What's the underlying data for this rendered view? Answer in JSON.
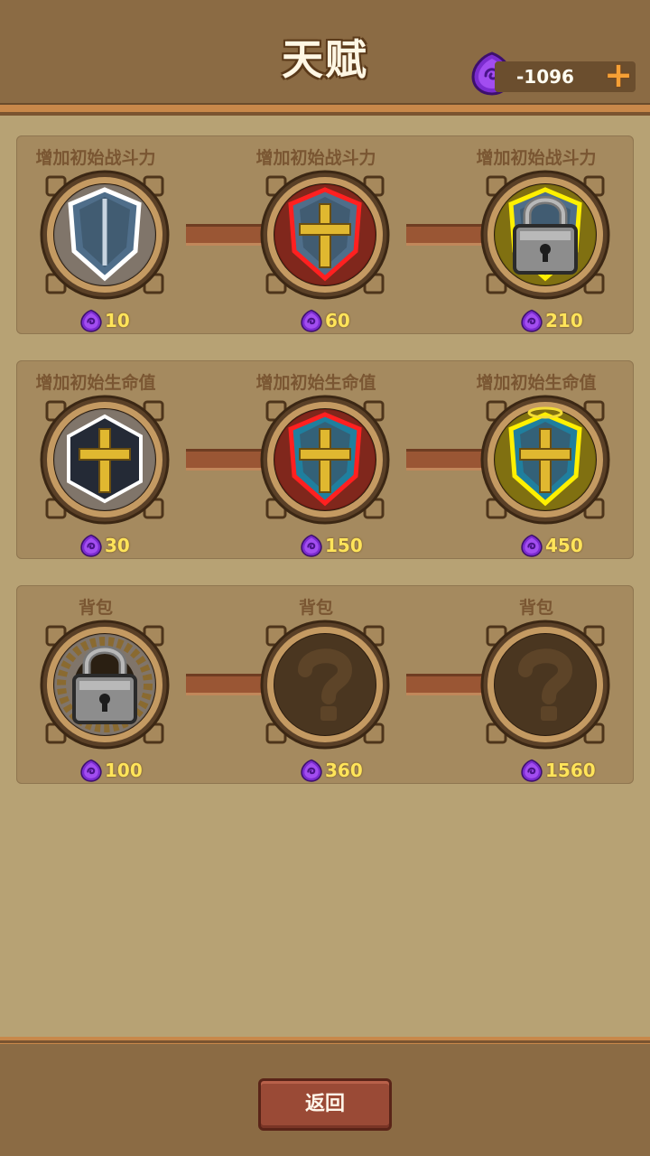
{
  "header": {
    "title": "天赋",
    "currency_value": "-1096",
    "currency_icon": "purple-gem-icon",
    "add_icon": "plus-icon"
  },
  "colors": {
    "background": "#b7a274",
    "header": "#8b6b44",
    "panel": "#a58a5f",
    "accent_orange": "#c8884a",
    "cost_text": "#ffe45a",
    "button": "#9a4a36",
    "glow_red": "#ff2a2a",
    "glow_yellow": "#fff200"
  },
  "rows": [
    {
      "nodes": [
        {
          "title": "增加初始战斗力",
          "cost": "10",
          "icon": "steel-shield-icon",
          "state": "unlocked",
          "glow": "white"
        },
        {
          "title": "增加初始战斗力",
          "cost": "60",
          "icon": "crossed-swords-shield-icon",
          "state": "unlocked",
          "glow": "red"
        },
        {
          "title": "增加初始战斗力",
          "cost": "210",
          "icon": "winged-shield-icon",
          "state": "locked",
          "glow": "yellow"
        }
      ]
    },
    {
      "nodes": [
        {
          "title": "增加初始生命值",
          "cost": "30",
          "icon": "cross-hexagon-icon",
          "state": "unlocked",
          "glow": "white"
        },
        {
          "title": "增加初始生命值",
          "cost": "150",
          "icon": "cross-horned-helm-icon",
          "state": "unlocked",
          "glow": "red"
        },
        {
          "title": "增加初始生命值",
          "cost": "450",
          "icon": "cross-halo-helm-icon",
          "state": "unlocked",
          "glow": "yellow"
        }
      ]
    },
    {
      "nodes": [
        {
          "title": "背包",
          "cost": "100",
          "icon": "rope-backpack-icon",
          "state": "locked",
          "glow": "white"
        },
        {
          "title": "背包",
          "cost": "360",
          "icon": "question-mark-icon",
          "state": "unknown",
          "glow": "none"
        },
        {
          "title": "背包",
          "cost": "1560",
          "icon": "question-mark-icon",
          "state": "unknown",
          "glow": "none"
        }
      ]
    }
  ],
  "footer": {
    "back_label": "返回"
  }
}
